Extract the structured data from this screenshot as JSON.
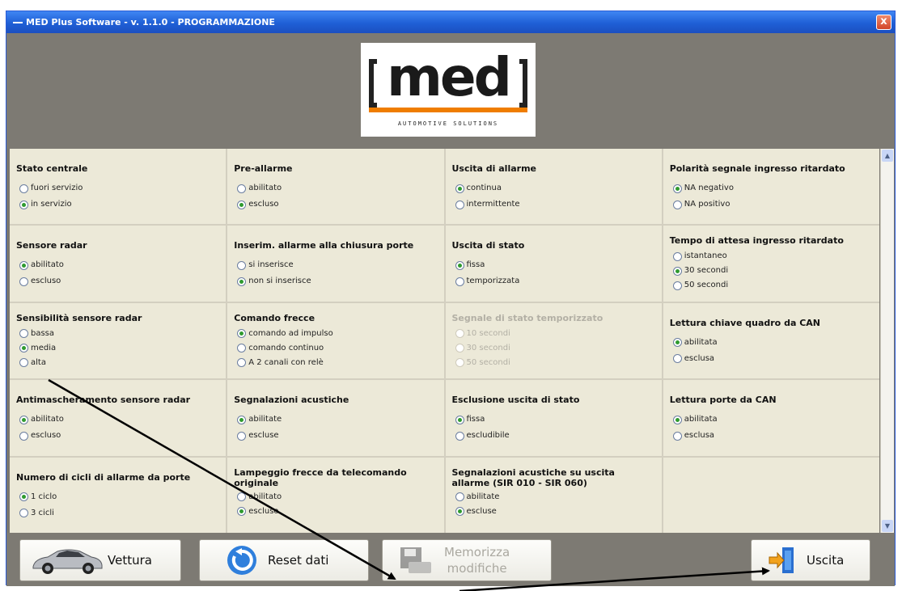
{
  "window": {
    "title": "MED Plus Software - v. 1.1.0 - PROGRAMMAZIONE",
    "close_glyph": "x"
  },
  "logo": {
    "text": "med",
    "subtitle": "AUTOMOTIVE SOLUTIONS"
  },
  "settings": [
    {
      "title": "Stato centrale",
      "options": [
        {
          "label": "fuori servizio",
          "selected": false
        },
        {
          "label": "in servizio",
          "selected": true
        }
      ]
    },
    {
      "title": "Pre-allarme",
      "options": [
        {
          "label": "abilitato",
          "selected": false
        },
        {
          "label": "escluso",
          "selected": true
        }
      ]
    },
    {
      "title": "Uscita di allarme",
      "options": [
        {
          "label": "continua",
          "selected": true
        },
        {
          "label": "intermittente",
          "selected": false
        }
      ]
    },
    {
      "title": "Polarità segnale ingresso ritardato",
      "options": [
        {
          "label": "NA negativo",
          "selected": true
        },
        {
          "label": "NA positivo",
          "selected": false
        }
      ]
    },
    {
      "title": "Sensore radar",
      "options": [
        {
          "label": "abilitato",
          "selected": true
        },
        {
          "label": "escluso",
          "selected": false
        }
      ]
    },
    {
      "title": "Inserim. allarme alla chiusura porte",
      "options": [
        {
          "label": "si inserisce",
          "selected": false
        },
        {
          "label": "non si inserisce",
          "selected": true
        }
      ]
    },
    {
      "title": "Uscita di stato",
      "options": [
        {
          "label": "fissa",
          "selected": true
        },
        {
          "label": "temporizzata",
          "selected": false
        }
      ]
    },
    {
      "title": "Tempo di attesa ingresso ritardato",
      "options": [
        {
          "label": "istantaneo",
          "selected": false
        },
        {
          "label": "30 secondi",
          "selected": true
        },
        {
          "label": "50 secondi",
          "selected": false
        }
      ]
    },
    {
      "title": "Sensibilità sensore radar",
      "options": [
        {
          "label": "bassa",
          "selected": false
        },
        {
          "label": "media",
          "selected": true
        },
        {
          "label": "alta",
          "selected": false
        }
      ]
    },
    {
      "title": "Comando frecce",
      "options": [
        {
          "label": "comando ad impulso",
          "selected": true
        },
        {
          "label": "comando continuo",
          "selected": false
        },
        {
          "label": "A 2 canali con relè",
          "selected": false
        }
      ]
    },
    {
      "title": "Segnale di stato temporizzato",
      "disabled": true,
      "options": [
        {
          "label": "10 secondi",
          "selected": false
        },
        {
          "label": "30 secondi",
          "selected": false
        },
        {
          "label": "50 secondi",
          "selected": false
        }
      ]
    },
    {
      "title": "Lettura chiave quadro da CAN",
      "options": [
        {
          "label": "abilitata",
          "selected": true
        },
        {
          "label": "esclusa",
          "selected": false
        }
      ]
    },
    {
      "title": "Antimascheramento sensore radar",
      "options": [
        {
          "label": "abilitato",
          "selected": true
        },
        {
          "label": "escluso",
          "selected": false
        }
      ]
    },
    {
      "title": "Segnalazioni acustiche",
      "options": [
        {
          "label": "abilitate",
          "selected": true
        },
        {
          "label": "escluse",
          "selected": false
        }
      ]
    },
    {
      "title": "Esclusione uscita di stato",
      "options": [
        {
          "label": "fissa",
          "selected": true
        },
        {
          "label": "escludibile",
          "selected": false
        }
      ]
    },
    {
      "title": "Lettura porte da CAN",
      "options": [
        {
          "label": "abilitata",
          "selected": true
        },
        {
          "label": "esclusa",
          "selected": false
        }
      ]
    },
    {
      "title": "Numero di cicli di allarme da porte",
      "options": [
        {
          "label": "1 ciclo",
          "selected": true
        },
        {
          "label": "3 cicli",
          "selected": false
        }
      ]
    },
    {
      "title": "Lampeggio frecce da telecomando originale",
      "options": [
        {
          "label": "abilitato",
          "selected": false
        },
        {
          "label": "escluso",
          "selected": true
        }
      ]
    },
    {
      "title": "Segnalazioni acustiche su uscita allarme (SIR 010 - SIR 060)",
      "options": [
        {
          "label": "abilitate",
          "selected": false
        },
        {
          "label": "escluse",
          "selected": true
        }
      ]
    },
    {
      "title": "",
      "options": []
    }
  ],
  "footer": {
    "vettura": "Vettura",
    "reset": "Reset dati",
    "memorizza_line1": "Memorizza",
    "memorizza_line2": "modifiche",
    "uscita": "Uscita"
  },
  "scroll": {
    "up": "▲",
    "down": "▼"
  },
  "colors": {
    "titlebar": "#1f5fd6",
    "panel": "#ece9d8",
    "header": "#7d7a73",
    "accent": "#ef7d00",
    "radio_on": "#2f9a2f"
  }
}
